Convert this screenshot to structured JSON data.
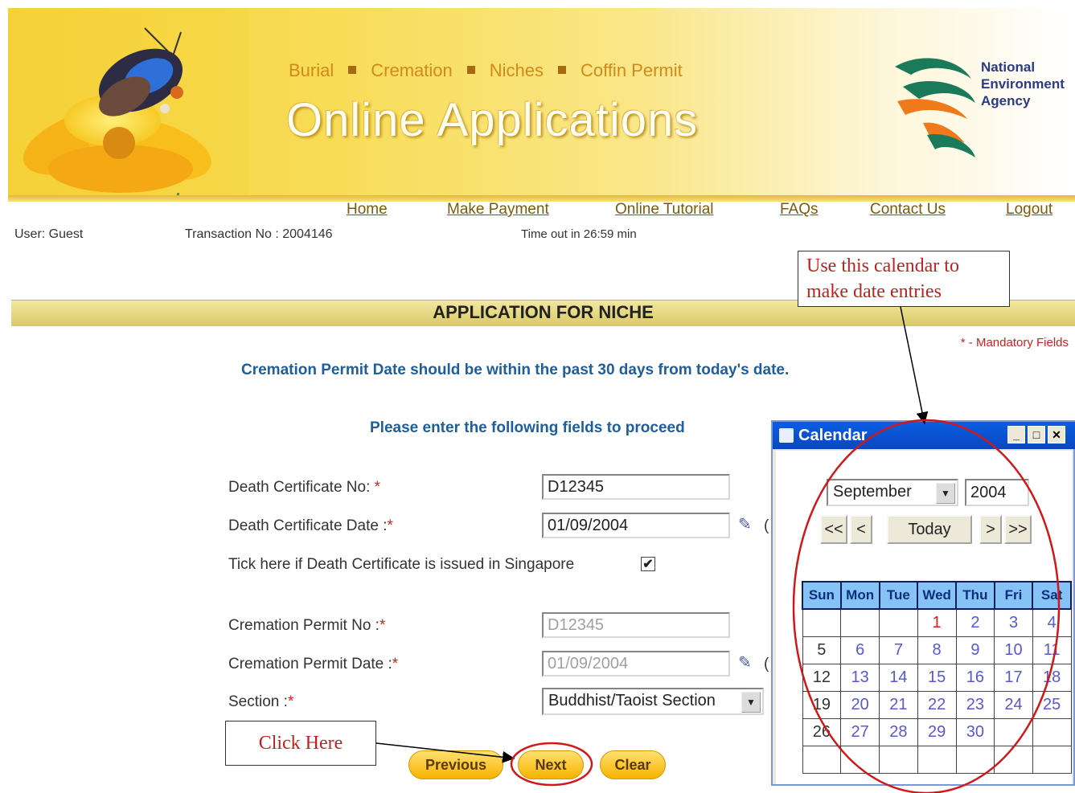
{
  "header": {
    "nav": [
      "Burial",
      "Cremation",
      "Niches",
      "Coffin Permit"
    ],
    "title": "Online Applications",
    "agency": [
      "National",
      "Environment",
      "Agency"
    ]
  },
  "menu": [
    "Home",
    "Make Payment",
    "Online Tutorial",
    "FAQs",
    "Contact Us",
    "Logout"
  ],
  "info": {
    "user": "User: Guest",
    "transaction": "Transaction No : 2004146",
    "timeout": "Time out in 26:59 min"
  },
  "annotations": {
    "calendar_note": "Use this calendar to make date entries",
    "click_note": "Click Here"
  },
  "page": {
    "title": "APPLICATION FOR NICHE",
    "mandatory": "* - Mandatory Fields",
    "message": "Cremation Permit Date should be within the past 30 days from today's date.",
    "prompt": "Please enter the following fields to proceed"
  },
  "form": {
    "death_cert_no_label": "Death Certificate No:",
    "death_cert_no_value": "D12345",
    "death_cert_date_label": "Death Certificate Date :",
    "death_cert_date_value": "01/09/2004",
    "singapore_label": "Tick here if Death Certificate is issued in Singapore",
    "singapore_checked": "✔",
    "cremation_permit_no_label": "Cremation Permit No :",
    "cremation_permit_no_value": "D12345",
    "cremation_permit_date_label": "Cremation Permit Date :",
    "cremation_permit_date_value": "01/09/2004",
    "section_label": "Section :",
    "section_value": "Buddhist/Taoist Section",
    "required_mark": "*",
    "paren": "("
  },
  "buttons": {
    "previous": "Previous",
    "next": "Next",
    "clear": "Clear"
  },
  "calendar": {
    "window_title": "Calendar",
    "month": "September",
    "year": "2004",
    "first": "<<",
    "prev": "<",
    "today": "Today",
    "next": ">",
    "last": ">>",
    "days": [
      "Sun",
      "Mon",
      "Tue",
      "Wed",
      "Thu",
      "Fri",
      "Sat"
    ],
    "weeks": [
      [
        "",
        "",
        "",
        "1",
        "2",
        "3",
        "4"
      ],
      [
        "5",
        "6",
        "7",
        "8",
        "9",
        "10",
        "11"
      ],
      [
        "12",
        "13",
        "14",
        "15",
        "16",
        "17",
        "18"
      ],
      [
        "19",
        "20",
        "21",
        "22",
        "23",
        "24",
        "25"
      ],
      [
        "26",
        "27",
        "28",
        "29",
        "30",
        "",
        ""
      ],
      [
        "",
        "",
        "",
        "",
        "",
        "",
        ""
      ]
    ]
  },
  "colors": {
    "accent_red": "#d02020",
    "title_blue": "#1f5d9b",
    "calendar_header": "#86c2f5",
    "xp_titlebar": "#0a5fe0"
  }
}
